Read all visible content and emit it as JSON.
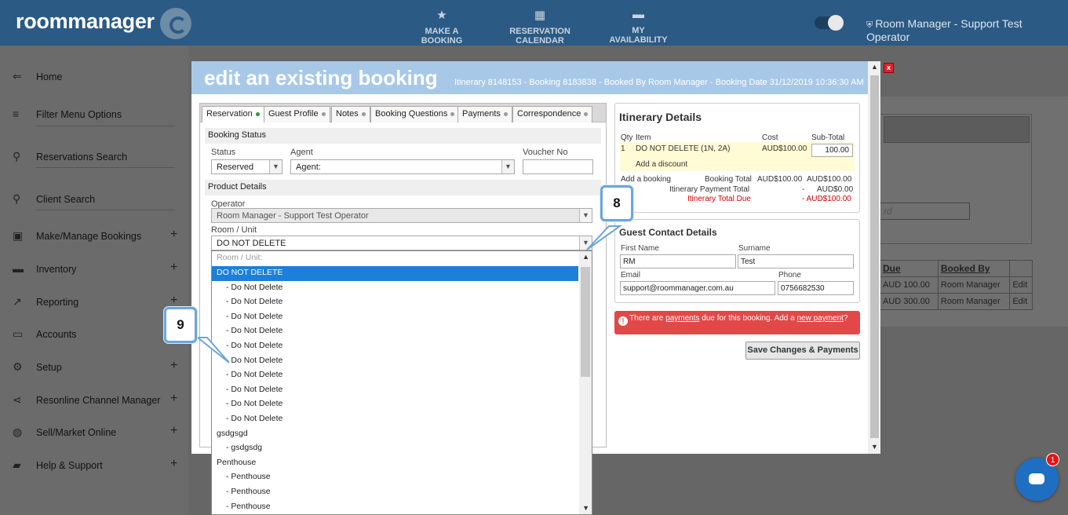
{
  "header": {
    "logo_text": "roommanager",
    "nav": [
      {
        "label": "MAKE A BOOKING",
        "icon": "star-icon"
      },
      {
        "label": "RESERVATION CALENDAR",
        "icon": "calendar-icon"
      },
      {
        "label": "MY AVAILABILITY",
        "icon": "bed-icon"
      }
    ],
    "user": "Room Manager - Support Test Operator"
  },
  "sidebar": {
    "items": [
      {
        "label": "Home",
        "icon": "arrow-left-icon",
        "plus": false
      },
      {
        "label": "Filter Menu Options",
        "icon": "filter-icon",
        "plus": false
      },
      {
        "label": "Reservations Search",
        "icon": "search-icon",
        "plus": false
      },
      {
        "label": "Client Search",
        "icon": "search-icon",
        "plus": false
      },
      {
        "label": "Make/Manage Bookings",
        "icon": "calendar-check-icon",
        "plus": true
      },
      {
        "label": "Inventory",
        "icon": "bed-icon",
        "plus": true
      },
      {
        "label": "Reporting",
        "icon": "trend-icon",
        "plus": true
      },
      {
        "label": "Accounts",
        "icon": "card-icon",
        "plus": false
      },
      {
        "label": "Setup",
        "icon": "gear-icon",
        "plus": true
      },
      {
        "label": "Resonline Channel Manager",
        "icon": "share-icon",
        "plus": true
      },
      {
        "label": "Sell/Market Online",
        "icon": "globe-icon",
        "plus": true
      },
      {
        "label": "Help & Support",
        "icon": "chat-icon",
        "plus": true
      }
    ]
  },
  "background": {
    "search_placeholder": "rd",
    "table_headers": [
      "Due",
      "Booked By",
      ""
    ],
    "rows": [
      [
        "AUD 100.00",
        "Room Manager",
        "Edit"
      ],
      [
        "AUD 300.00",
        "Room Manager",
        "Edit"
      ]
    ]
  },
  "modal": {
    "title": "edit an existing booking",
    "subtitle": "Itinerary 8148153 - Booking 8183838 - Booked By Room Manager - Booking Date 31/12/2019 10:36:30 AM",
    "close": "x",
    "tabs": [
      "Reservation",
      "Guest Profile",
      "Notes",
      "Booking Questions",
      "Payments",
      "Correspondence"
    ],
    "booking_status": {
      "header": "Booking Status",
      "status_label": "Status",
      "status_value": "Reserved",
      "agent_label": "Agent",
      "agent_value": "Agent:",
      "voucher_label": "Voucher No",
      "voucher_value": ""
    },
    "product": {
      "header": "Product Details",
      "operator_label": "Operator",
      "operator_value": "Room Manager - Support Test Operator",
      "room_label": "Room / Unit",
      "room_value": "DO NOT DELETE"
    },
    "dropdown_options": [
      {
        "label": "Room / Unit:",
        "type": "placeholder"
      },
      {
        "label": "DO NOT DELETE",
        "type": "selected"
      },
      {
        "label": "- Do Not Delete",
        "type": "sub"
      },
      {
        "label": "- Do Not Delete",
        "type": "sub"
      },
      {
        "label": "- Do Not Delete",
        "type": "sub"
      },
      {
        "label": "- Do Not Delete",
        "type": "sub"
      },
      {
        "label": "- Do Not Delete",
        "type": "sub"
      },
      {
        "label": "- Do Not Delete",
        "type": "sub"
      },
      {
        "label": "- Do Not Delete",
        "type": "sub"
      },
      {
        "label": "- Do Not Delete",
        "type": "sub"
      },
      {
        "label": "- Do Not Delete",
        "type": "sub"
      },
      {
        "label": "- Do Not Delete",
        "type": "sub"
      },
      {
        "label": "gsdgsgd",
        "type": "group"
      },
      {
        "label": "- gsdgsdg",
        "type": "sub"
      },
      {
        "label": "Penthouse",
        "type": "group"
      },
      {
        "label": "- Penthouse",
        "type": "sub"
      },
      {
        "label": "- Penthouse",
        "type": "sub"
      },
      {
        "label": "- Penthouse",
        "type": "sub"
      }
    ],
    "itinerary": {
      "title": "Itinerary Details",
      "col_qty": "Qty",
      "col_item": "Item",
      "col_cost": "Cost",
      "col_subtotal": "Sub-Total",
      "qty": "1",
      "item": "DO NOT DELETE (1N, 2A)",
      "cost": "AUD$100.00",
      "subtotal": "100.00",
      "add_discount": "Add a discount",
      "add_booking": "Add a booking",
      "booking_total_label": "Booking Total",
      "booking_total_cost": "AUD$100.00",
      "booking_total_sub": "AUD$100.00",
      "payment_total_label": "Itinerary Payment Total",
      "payment_total_cost": "-",
      "payment_total_sub": "AUD$0.00",
      "total_due_label": "Itinerary Total Due",
      "total_due_value": "- AUD$100.00"
    },
    "guest": {
      "title": "Guest Contact Details",
      "first_label": "First Name",
      "first_value": "RM",
      "surname_label": "Surname",
      "surname_value": "Test",
      "email_label": "Email",
      "email_value": "support@roommanager.com.au",
      "phone_label": "Phone",
      "phone_value": "0756682530"
    },
    "alert": {
      "pre": "There are ",
      "link1": "payments",
      "mid": " due for this booking. Add a ",
      "link2": "new payment",
      "post": "?"
    },
    "save_button": "Save Changes & Payments"
  },
  "callouts": [
    "8",
    "9"
  ],
  "chat_badge": "1"
}
